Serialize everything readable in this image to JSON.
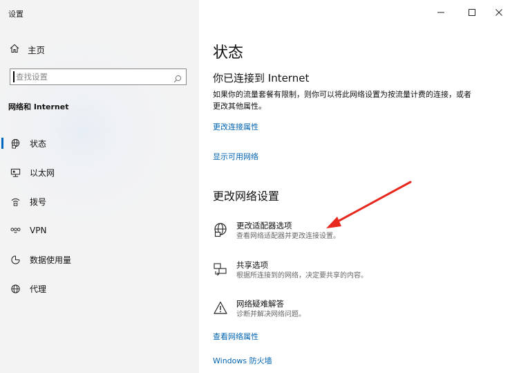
{
  "window": {
    "title": "设置",
    "controls": {
      "minimize": "–",
      "maximize": "□",
      "close": "✕"
    }
  },
  "sidebar": {
    "home_label": "主页",
    "search_placeholder": "查找设置",
    "section_title": "网络和 Internet",
    "items": [
      {
        "label": "状态",
        "icon": "status-globe-icon",
        "active": true
      },
      {
        "label": "以太网",
        "icon": "ethernet-icon",
        "active": false
      },
      {
        "label": "拨号",
        "icon": "dialup-icon",
        "active": false
      },
      {
        "label": "VPN",
        "icon": "vpn-icon",
        "active": false
      },
      {
        "label": "数据使用量",
        "icon": "data-usage-icon",
        "active": false
      },
      {
        "label": "代理",
        "icon": "proxy-globe-icon",
        "active": false
      }
    ]
  },
  "main": {
    "title": "状态",
    "connection_title": "你已连接到 Internet",
    "connection_desc": "如果你的流量套餐有限制，则你可以将此网络设置为按流量计费的连接，或者更改其他属性。",
    "link_change_props": "更改连接属性",
    "link_show_networks": "显示可用网络",
    "section_title": "更改网络设置",
    "options": [
      {
        "title": "更改适配器选项",
        "subtitle": "查看网络适配器并更改连接设置。",
        "icon": "adapter-globe-icon"
      },
      {
        "title": "共享选项",
        "subtitle": "根据所连接到的网络，决定要共享的内容。",
        "icon": "sharing-icon"
      },
      {
        "title": "网络疑难解答",
        "subtitle": "诊断并解决网络问题。",
        "icon": "warning-icon"
      }
    ],
    "link_view_props": "查看网络属性",
    "link_firewall": "Windows 防火墙"
  },
  "colors": {
    "accent": "#0067c0",
    "link": "#0063b1",
    "annotation_arrow": "#e8271e"
  }
}
